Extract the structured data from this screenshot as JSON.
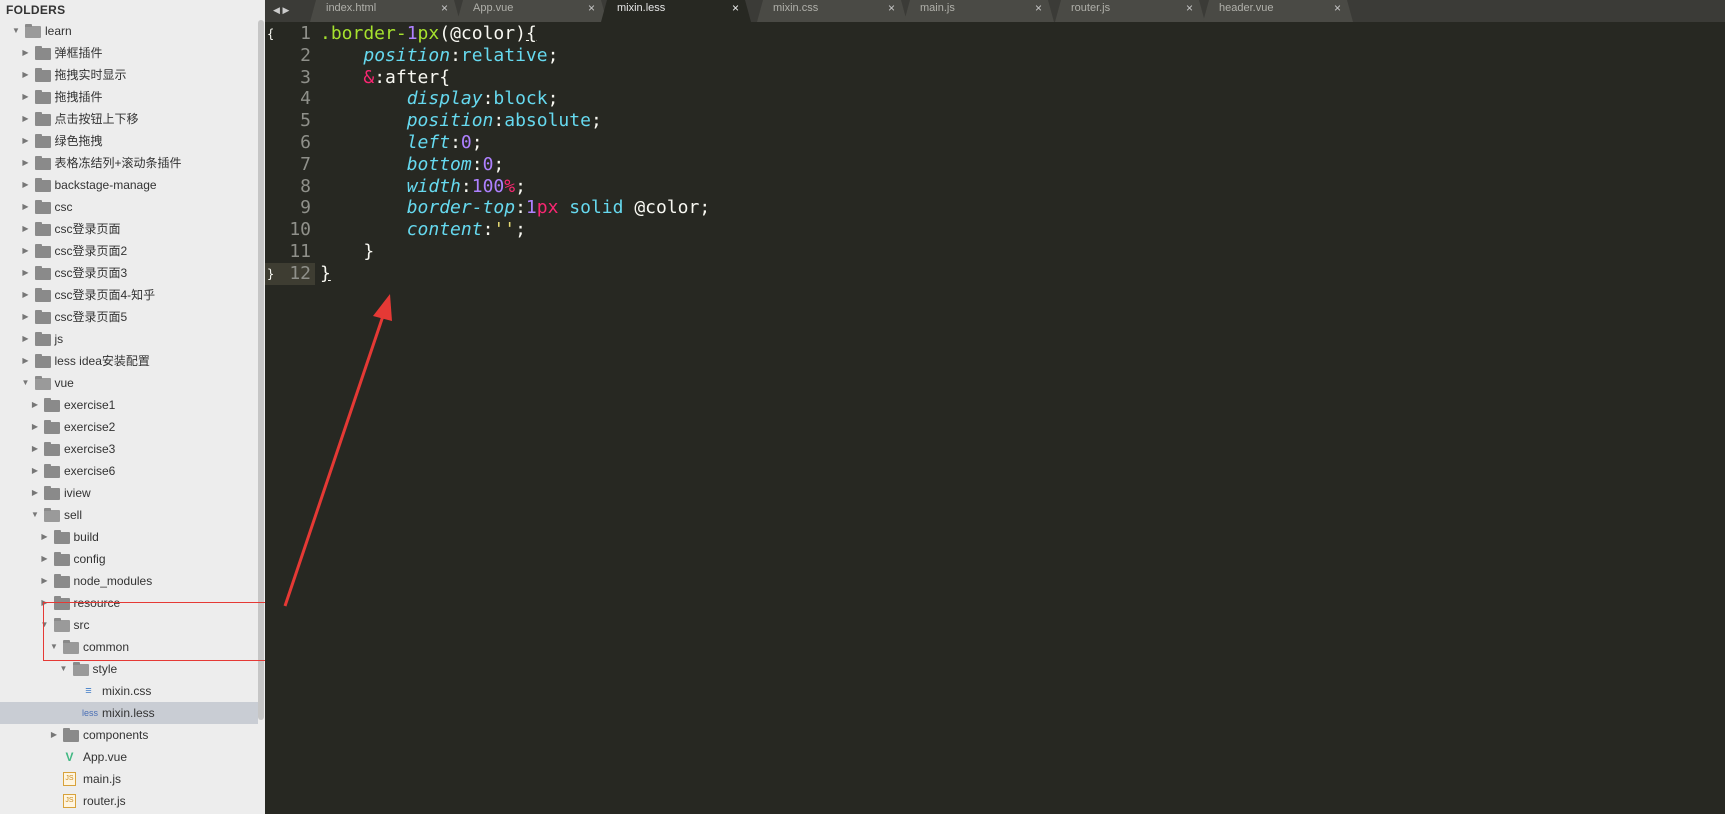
{
  "sidebar": {
    "title": "FOLDERS",
    "items": [
      {
        "label": "learn",
        "depth": 0,
        "type": "folder",
        "open": true
      },
      {
        "label": "弹框插件",
        "depth": 1,
        "type": "folder",
        "open": false
      },
      {
        "label": "拖拽实时显示",
        "depth": 1,
        "type": "folder",
        "open": false
      },
      {
        "label": "拖拽插件",
        "depth": 1,
        "type": "folder",
        "open": false
      },
      {
        "label": "点击按钮上下移",
        "depth": 1,
        "type": "folder",
        "open": false
      },
      {
        "label": "绿色拖拽",
        "depth": 1,
        "type": "folder",
        "open": false
      },
      {
        "label": "表格冻结列+滚动条插件",
        "depth": 1,
        "type": "folder",
        "open": false
      },
      {
        "label": "backstage-manage",
        "depth": 1,
        "type": "folder",
        "open": false
      },
      {
        "label": "csc",
        "depth": 1,
        "type": "folder",
        "open": false
      },
      {
        "label": "csc登录页面",
        "depth": 1,
        "type": "folder",
        "open": false
      },
      {
        "label": "csc登录页面2",
        "depth": 1,
        "type": "folder",
        "open": false
      },
      {
        "label": "csc登录页面3",
        "depth": 1,
        "type": "folder",
        "open": false
      },
      {
        "label": "csc登录页面4-知乎",
        "depth": 1,
        "type": "folder",
        "open": false
      },
      {
        "label": "csc登录页面5",
        "depth": 1,
        "type": "folder",
        "open": false
      },
      {
        "label": "js",
        "depth": 1,
        "type": "folder",
        "open": false
      },
      {
        "label": "less idea安装配置",
        "depth": 1,
        "type": "folder",
        "open": false
      },
      {
        "label": "vue",
        "depth": 1,
        "type": "folder",
        "open": true
      },
      {
        "label": "exercise1",
        "depth": 2,
        "type": "folder",
        "open": false
      },
      {
        "label": "exercise2",
        "depth": 2,
        "type": "folder",
        "open": false
      },
      {
        "label": "exercise3",
        "depth": 2,
        "type": "folder",
        "open": false
      },
      {
        "label": "exercise6",
        "depth": 2,
        "type": "folder",
        "open": false
      },
      {
        "label": "iview",
        "depth": 2,
        "type": "folder",
        "open": false
      },
      {
        "label": "sell",
        "depth": 2,
        "type": "folder",
        "open": true
      },
      {
        "label": "build",
        "depth": 3,
        "type": "folder",
        "open": false
      },
      {
        "label": "config",
        "depth": 3,
        "type": "folder",
        "open": false
      },
      {
        "label": "node_modules",
        "depth": 3,
        "type": "folder",
        "open": false
      },
      {
        "label": "resource",
        "depth": 3,
        "type": "folder",
        "open": false
      },
      {
        "label": "src",
        "depth": 3,
        "type": "folder",
        "open": true
      },
      {
        "label": "common",
        "depth": 4,
        "type": "folder",
        "open": true
      },
      {
        "label": "style",
        "depth": 5,
        "type": "folder",
        "open": true
      },
      {
        "label": "mixin.css",
        "depth": 6,
        "type": "file",
        "icon": "css",
        "icon_text": "≡"
      },
      {
        "label": "mixin.less",
        "depth": 6,
        "type": "file",
        "icon": "less",
        "icon_text": "less",
        "selected": true
      },
      {
        "label": "components",
        "depth": 4,
        "type": "folder",
        "open": false
      },
      {
        "label": "App.vue",
        "depth": 4,
        "type": "file",
        "icon": "vue",
        "icon_text": "V"
      },
      {
        "label": "main.js",
        "depth": 4,
        "type": "file",
        "icon": "js",
        "icon_text": "JS"
      },
      {
        "label": "router.js",
        "depth": 4,
        "type": "file",
        "icon": "js",
        "icon_text": "JS"
      }
    ]
  },
  "tabs": {
    "nav_left": "◀",
    "nav_right": "▶",
    "items": [
      {
        "label": "index.html",
        "close": "×",
        "active": false
      },
      {
        "label": "App.vue",
        "close": "×",
        "active": false
      },
      {
        "label": "mixin.less",
        "close": "×",
        "active": true
      },
      {
        "label": "mixin.css",
        "close": "×",
        "active": false
      },
      {
        "label": "main.js",
        "close": "×",
        "active": false
      },
      {
        "label": "router.js",
        "close": "×",
        "active": false
      },
      {
        "label": "header.vue",
        "close": "×",
        "active": false
      }
    ]
  },
  "editor": {
    "fold_open": "{",
    "fold_close": "}",
    "lines": [
      {
        "n": "1",
        "tokens": [
          [
            "sel",
            ".border-"
          ],
          [
            "num",
            "1"
          ],
          [
            "sel",
            "px"
          ],
          [
            "white",
            "(@color)"
          ],
          [
            "under",
            "{"
          ]
        ]
      },
      {
        "n": "2",
        "tokens": [
          [
            "white",
            "    "
          ],
          [
            "prop",
            "position"
          ],
          [
            "white",
            ":"
          ],
          [
            "val",
            "relative"
          ],
          [
            "white",
            ";"
          ]
        ]
      },
      {
        "n": "3",
        "tokens": [
          [
            "white",
            "    "
          ],
          [
            "amp",
            "&"
          ],
          [
            "white",
            ":after{"
          ]
        ]
      },
      {
        "n": "4",
        "tokens": [
          [
            "white",
            "        "
          ],
          [
            "prop",
            "display"
          ],
          [
            "white",
            ":"
          ],
          [
            "val",
            "block"
          ],
          [
            "white",
            ";"
          ]
        ]
      },
      {
        "n": "5",
        "tokens": [
          [
            "white",
            "        "
          ],
          [
            "prop",
            "position"
          ],
          [
            "white",
            ":"
          ],
          [
            "val",
            "absolute"
          ],
          [
            "white",
            ";"
          ]
        ]
      },
      {
        "n": "6",
        "tokens": [
          [
            "white",
            "        "
          ],
          [
            "prop",
            "left"
          ],
          [
            "white",
            ":"
          ],
          [
            "num",
            "0"
          ],
          [
            "white",
            ";"
          ]
        ]
      },
      {
        "n": "7",
        "tokens": [
          [
            "white",
            "        "
          ],
          [
            "prop",
            "bottom"
          ],
          [
            "white",
            ":"
          ],
          [
            "num",
            "0"
          ],
          [
            "white",
            ";"
          ]
        ]
      },
      {
        "n": "8",
        "tokens": [
          [
            "white",
            "        "
          ],
          [
            "prop",
            "width"
          ],
          [
            "white",
            ":"
          ],
          [
            "num",
            "100"
          ],
          [
            "unit",
            "%"
          ],
          [
            "white",
            ";"
          ]
        ]
      },
      {
        "n": "9",
        "tokens": [
          [
            "white",
            "        "
          ],
          [
            "prop",
            "border-top"
          ],
          [
            "white",
            ":"
          ],
          [
            "num",
            "1"
          ],
          [
            "unit",
            "px"
          ],
          [
            "val",
            " solid"
          ],
          [
            "white",
            " @color;"
          ]
        ]
      },
      {
        "n": "10",
        "tokens": [
          [
            "white",
            "        "
          ],
          [
            "prop",
            "content"
          ],
          [
            "white",
            ":"
          ],
          [
            "str",
            "''"
          ],
          [
            "white",
            ";"
          ]
        ]
      },
      {
        "n": "11",
        "tokens": [
          [
            "white",
            "    }"
          ]
        ]
      },
      {
        "n": "12",
        "tokens": [
          [
            "under",
            "}"
          ]
        ],
        "current": true
      }
    ]
  },
  "colors": {
    "annotation": "#e53935",
    "editor_bg": "#272822",
    "sidebar_bg": "#ededed"
  }
}
